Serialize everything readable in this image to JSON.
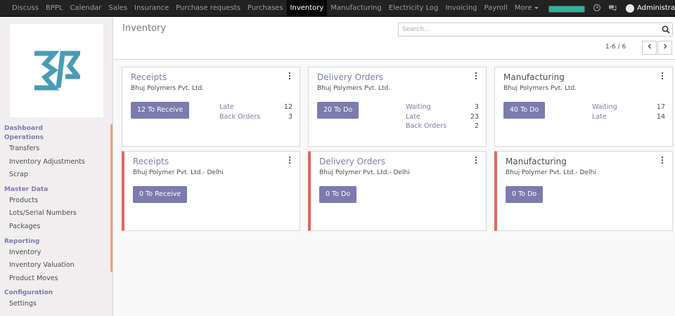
{
  "topbar": {
    "menu": [
      "Discuss",
      "BPPL",
      "Calendar",
      "Sales",
      "Insurance",
      "Purchase requests",
      "Purchases",
      "Inventory",
      "Manufacturing",
      "Electricity Log",
      "Invoicing",
      "Payroll"
    ],
    "more_label": "More",
    "active": "Inventory",
    "progress": 1.0,
    "username": "Administrato"
  },
  "sidebar": {
    "dashboard": "Dashboard",
    "operations": {
      "title": "Operations",
      "items": [
        "Transfers",
        "Inventory Adjustments",
        "Scrap"
      ]
    },
    "master_data": {
      "title": "Master Data",
      "items": [
        "Products",
        "Lots/Serial Numbers",
        "Packages"
      ]
    },
    "reporting": {
      "title": "Reporting",
      "items": [
        "Inventory",
        "Inventory Valuation",
        "Product Moves"
      ]
    },
    "configuration": {
      "title": "Configuration",
      "items": [
        "Settings"
      ]
    }
  },
  "control_panel": {
    "title": "Inventory",
    "search_placeholder": "Search...",
    "pager": "1-6 / 6"
  },
  "cards": [
    {
      "name": "Receipts",
      "company": "Bhuj Polymers Pvt. Ltd.",
      "action": "12 To Receive",
      "stats": [
        {
          "label": "Late",
          "value": "12"
        },
        {
          "label": "Back Orders",
          "value": "3"
        }
      ]
    },
    {
      "name": "Delivery Orders",
      "company": "Bhuj Polymers Pvt. Ltd.",
      "action": "20 To Do",
      "stats": [
        {
          "label": "Waiting",
          "value": "3"
        },
        {
          "label": "Late",
          "value": "23"
        },
        {
          "label": "Back Orders",
          "value": "2"
        }
      ]
    },
    {
      "name": "Manufacturing",
      "company": "Bhuj Polymers Pvt. Ltd.",
      "action": "40 To Do",
      "stats": [
        {
          "label": "Waiting",
          "value": "17"
        },
        {
          "label": "Late",
          "value": "14"
        }
      ]
    },
    {
      "name": "Receipts",
      "company": "Bhuj Polymer Pvt. Ltd.- Delhi",
      "action": "0 To Receive",
      "stats": []
    },
    {
      "name": "Delivery Orders",
      "company": "Bhuj Polymer Pvt. Ltd.- Delhi",
      "action": "0 To Do",
      "stats": []
    },
    {
      "name": "Manufacturing",
      "company": "Bhuj Polymer Pvt. Ltd.- Delhi",
      "action": "0 To Do",
      "stats": []
    }
  ],
  "colors": {
    "brand": "#7c7bad",
    "topbar": "#222222",
    "warning_border": "#e2665f",
    "sidebar_accent": "#f0a07f",
    "logo": "#4a9bb5",
    "progress": "#21b799"
  },
  "icons": [
    "clock-icon",
    "chat-icon",
    "search-icon",
    "chevron-left-icon",
    "chevron-right-icon",
    "kebab-menu-icon"
  ]
}
